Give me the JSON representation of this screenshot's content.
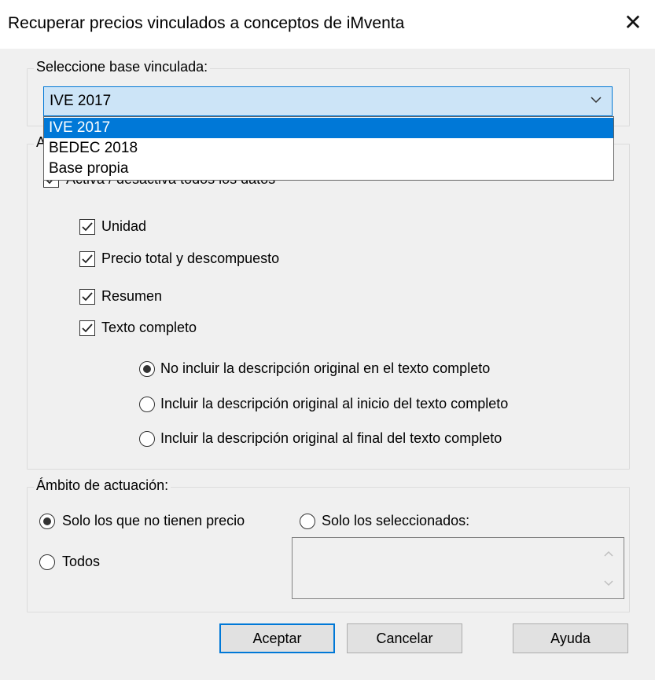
{
  "window": {
    "title": "Recuperar precios vinculados a conceptos de iMventa",
    "close_glyph": "✕"
  },
  "base_group": {
    "label": "Seleccione base vinculada:",
    "selected": "IVE 2017",
    "options": [
      "IVE 2017",
      "BEDEC 2018",
      "Base propia"
    ]
  },
  "data_group": {
    "label": "A",
    "toggle_all": {
      "label": "Activa / desactiva todos los datos",
      "checked": true
    },
    "items": [
      {
        "label": "Unidad",
        "checked": true
      },
      {
        "label": "Precio total y descompuesto",
        "checked": true
      },
      {
        "label": "Resumen",
        "checked": true
      },
      {
        "label": "Texto completo",
        "checked": true
      }
    ],
    "text_options": [
      {
        "label": "No incluir la descripción original en el texto completo",
        "selected": true
      },
      {
        "label": "Incluir la descripción original al inicio del texto completo",
        "selected": false
      },
      {
        "label": "Incluir la descripción original al final del texto completo",
        "selected": false
      }
    ]
  },
  "scope_group": {
    "label": "Ámbito de actuación:",
    "options": [
      {
        "label": "Solo los que no tienen precio",
        "selected": true
      },
      {
        "label": "Solo los seleccionados:",
        "selected": false
      },
      {
        "label": "Todos",
        "selected": false
      }
    ]
  },
  "buttons": {
    "accept": "Aceptar",
    "cancel": "Cancelar",
    "help": "Ayuda"
  }
}
